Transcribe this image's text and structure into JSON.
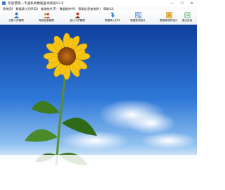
{
  "window": {
    "title": "欢迎使用一卡通系统数据查询系统V2.0"
  },
  "menu": {
    "items": [
      {
        "label": "系统(S)"
      },
      {
        "label": "数据录入打印(D)"
      },
      {
        "label": "查询统计(T)"
      },
      {
        "label": "数据维护(A)"
      },
      {
        "label": "帮助信息查询(H)"
      },
      {
        "label": "帮助(U)"
      }
    ]
  },
  "toolbar": {
    "buttons": [
      {
        "label": "分配人员管理",
        "icon": "people-icon",
        "color": "#3b6fc4"
      },
      {
        "label": "考勤信息管理",
        "icon": "group-icon",
        "color": "#e0802a"
      },
      {
        "label": "会计人员管理",
        "icon": "accountant-icon",
        "color": "#c0392b"
      },
      {
        "label": "数据录入打印",
        "icon": "print-icon",
        "color": "#2f7fd0"
      },
      {
        "label": "数据查询统计",
        "icon": "search-icon",
        "color": "#3b6fc4"
      },
      {
        "label": "数据库维护统计",
        "icon": "database-icon",
        "color": "#e0a020"
      },
      {
        "label": "退出系统",
        "icon": "exit-icon",
        "color": "#3aa05a"
      }
    ]
  },
  "background": {
    "image": "sunflower-sky"
  }
}
